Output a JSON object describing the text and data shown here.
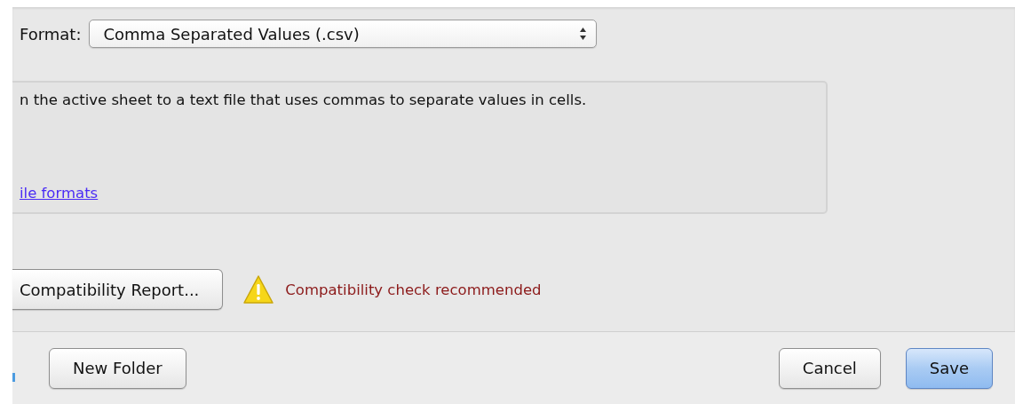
{
  "format": {
    "label": "Format:",
    "value": "Comma Separated Values (.csv)"
  },
  "description": {
    "text": "n the active sheet to a text file that uses commas to separate values in cells.",
    "link": "ile formats"
  },
  "compatibility": {
    "button": "Compatibility Report...",
    "warning": "Compatibility check recommended"
  },
  "footer": {
    "left_buttons": [
      {
        "label": "New Folder",
        "default": false
      }
    ],
    "right_buttons": [
      {
        "label": "Cancel",
        "default": false
      },
      {
        "label": "Save",
        "default": true
      }
    ]
  }
}
